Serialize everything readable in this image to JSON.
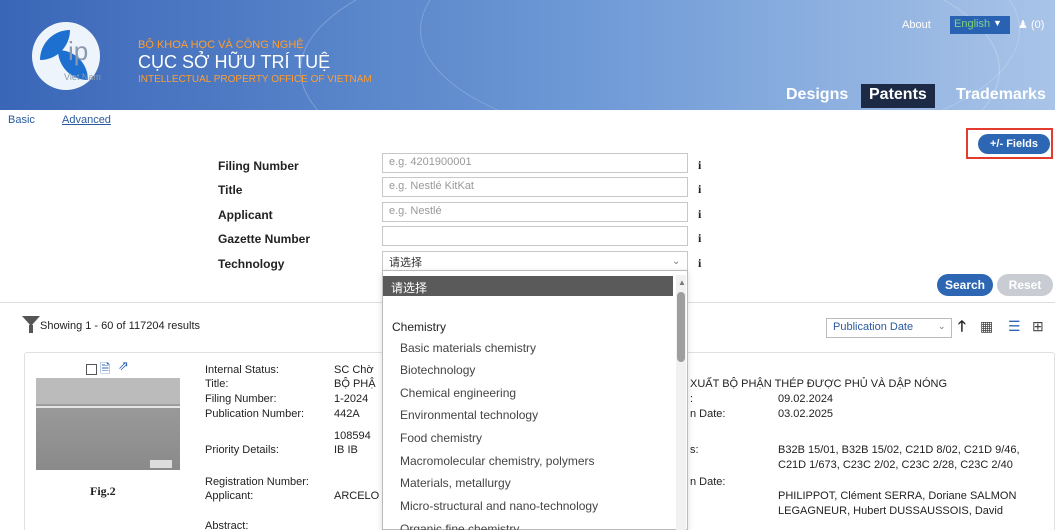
{
  "header": {
    "logo_text": "ip",
    "logo_sub": "Viet Nam",
    "ministry": "BỘ KHOA HỌC VÀ CÔNG NGHỆ",
    "agency_vn": "CỤC SỞ HỮU TRÍ TUỆ",
    "agency_en": "INTELLECTUAL PROPERTY OFFICE OF VIETNAM",
    "about": "About",
    "language": "English",
    "cart": "(0)",
    "tabs": [
      "Designs",
      "Patents",
      "Trademarks"
    ],
    "active_tab": "Patents"
  },
  "search": {
    "basic": "Basic",
    "advanced": "Advanced",
    "fields_button": "+/- Fields",
    "fields": [
      {
        "label": "Filing Number",
        "placeholder": "e.g. 4201900001"
      },
      {
        "label": "Title",
        "placeholder": "e.g. Nestlé KitKat"
      },
      {
        "label": "Applicant",
        "placeholder": "e.g. Nestlé"
      },
      {
        "label": "Gazette Number",
        "placeholder": ""
      },
      {
        "label": "Technology",
        "value": "请选择"
      }
    ],
    "search_button": "Search",
    "reset_button": "Reset"
  },
  "dropdown": {
    "selected": "请选择",
    "group": "Chemistry",
    "options": [
      "Basic materials chemistry",
      "Biotechnology",
      "Chemical engineering",
      "Environmental technology",
      "Food chemistry",
      "Macromolecular chemistry, polymers",
      "Materials, metallurgy",
      "Micro-structural and nano-technology",
      "Organic fine chemistry"
    ]
  },
  "results": {
    "showing": "Showing 1 - 60 of 117204 results",
    "sort_by": "Publication Date"
  },
  "record": {
    "fig_label": "Fig.2",
    "left_labels": [
      "Internal Status:",
      "Title:",
      "Filing Number:",
      "Publication Number:",
      "Priority Details:",
      "Registration Number:",
      "Applicant:",
      "Abstract:"
    ],
    "left_values": [
      "SC Chờ",
      "BỘ PHẬ",
      "1-2024",
      "442A",
      "108594",
      "IB   IB",
      "ARCELO"
    ],
    "title_tail": "XUẤT BỘ PHẬN THÉP ĐƯỢC PHỦ VÀ DẬP NÓNG",
    "right_labels": [
      ":",
      "n Date:",
      "s:",
      "n Date:"
    ],
    "right_values": [
      "09.02.2024",
      "03.02.2025",
      "B32B 15/01, B32B 15/02, C21D 8/02, C21D 9/46,",
      "C21D 1/673, C23C 2/02, C23C 2/28, C23C 2/40",
      "PHILIPPOT, Clément SERRA, Doriane SALMON",
      "LEGAGNEUR, Hubert DUSSAUSSOIS, David"
    ]
  }
}
